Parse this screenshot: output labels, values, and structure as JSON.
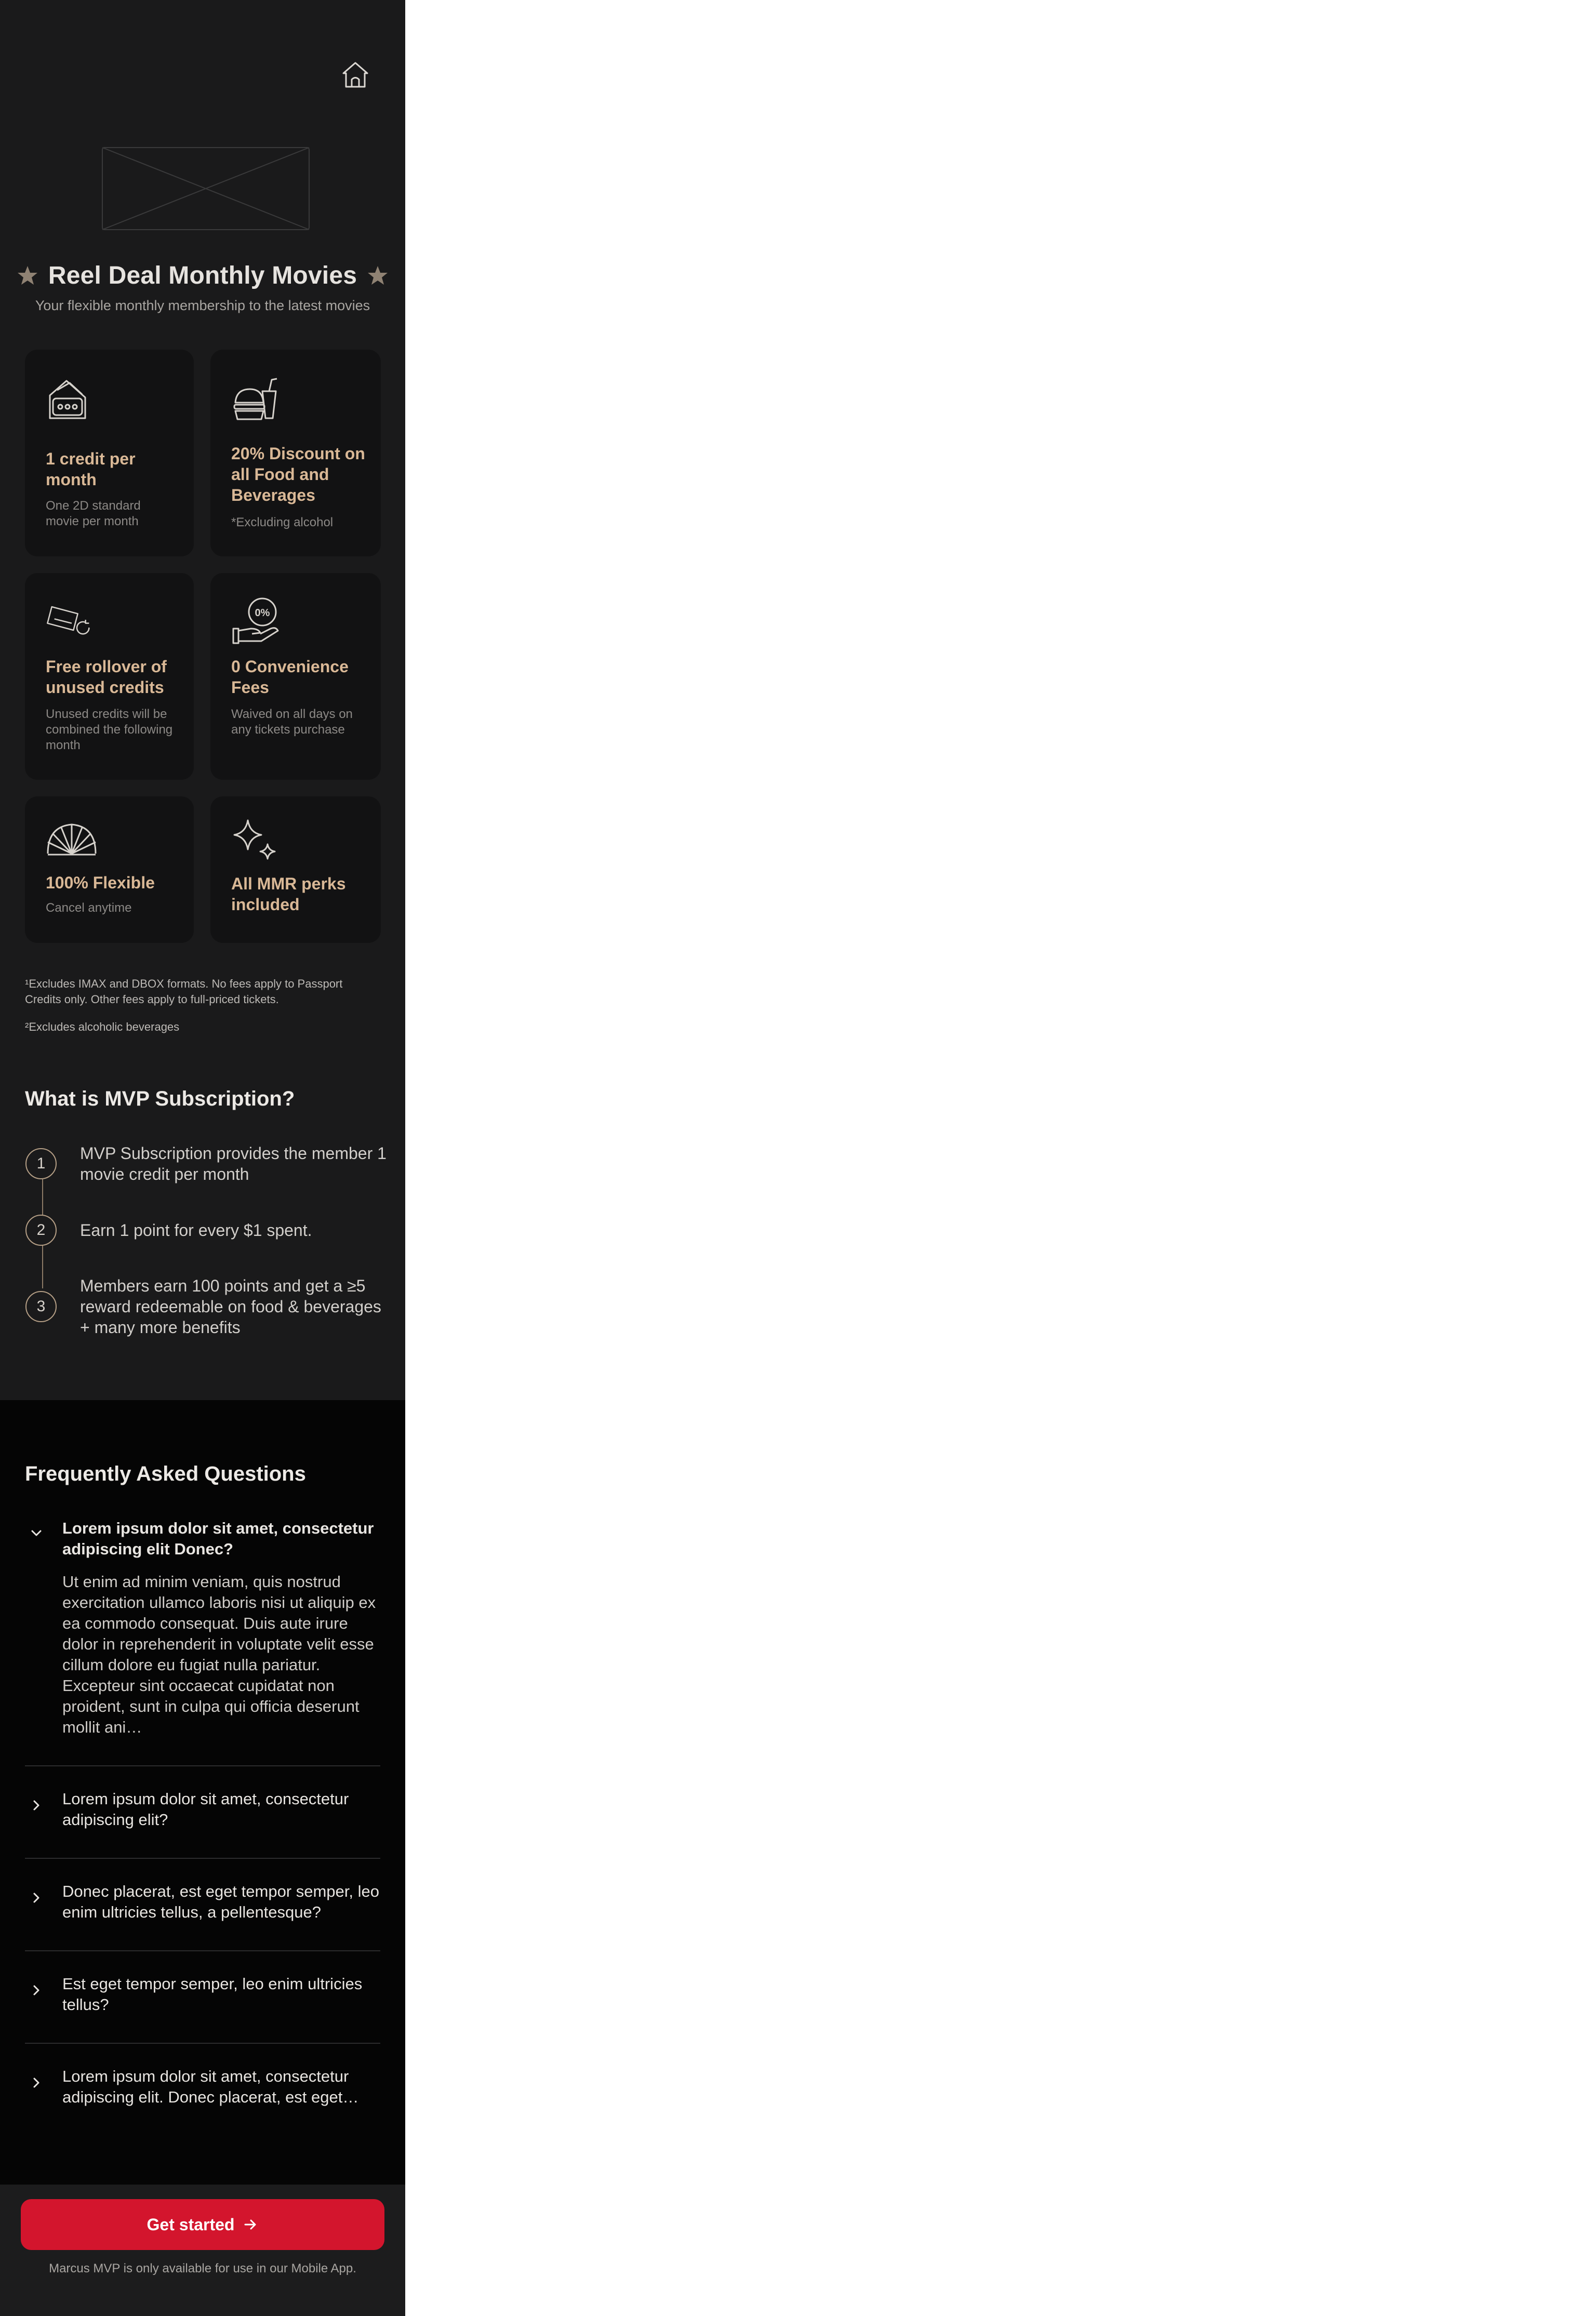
{
  "header": {
    "home_icon": "home-icon"
  },
  "hero": {
    "image_placeholder": "image-placeholder",
    "title": "Reel Deal Monthly Movies",
    "subtitle": "Your flexible monthly membership to the latest movies"
  },
  "benefits": [
    {
      "icon": "ticket-icon",
      "title": "1 credit per month",
      "description": "One 2D standard movie per month"
    },
    {
      "icon": "food-drink-icon",
      "title": "20% Discount on all Food and Beverages",
      "description": "*Excluding alcohol"
    },
    {
      "icon": "ticket-rollover-icon",
      "title": "Free rollover of unused credits",
      "description": "Unused credits will be combined the following month"
    },
    {
      "icon": "zero-percent-hand-icon",
      "title": "0 Convenience Fees",
      "description": "Waived on all days on any tickets purchase"
    },
    {
      "icon": "flexible-fan-icon",
      "title": "100% Flexible",
      "description": "Cancel anytime"
    },
    {
      "icon": "sparkles-icon",
      "title": "All MMR perks included",
      "description": ""
    }
  ],
  "footnotes": [
    "¹Excludes IMAX and DBOX formats. No fees apply to Passport Credits only. Other fees apply to full‑priced tickets.",
    "²Excludes alcoholic beverages"
  ],
  "mvp": {
    "title": "What is MVP Subscription?",
    "steps": [
      {
        "number": "1",
        "text": "MVP Subscription provides the member 1 movie credit per month"
      },
      {
        "number": "2",
        "text": "Earn 1 point for every $1 spent."
      },
      {
        "number": "3",
        "text": "Members earn 100 points and get a ≥5 reward redeemable on food & beverages + many more benefits"
      }
    ]
  },
  "faq": {
    "title": "Frequently Asked Questions",
    "items": [
      {
        "question": "Lorem ipsum dolor sit amet, consectetur adipiscing elit Donec?",
        "expanded": true,
        "answer": "Ut enim ad minim veniam, quis nostrud exercitation ullamco laboris nisi ut aliquip ex ea commodo consequat. Duis aute irure dolor in reprehenderit in voluptate velit esse cillum dolore eu fugiat nulla pariatur. Excepteur sint occaecat cupidatat non proident, sunt in culpa qui officia deserunt mollit ani…"
      },
      {
        "question": "Lorem ipsum dolor sit amet, consectetur adipiscing elit?",
        "expanded": false
      },
      {
        "question": "Donec placerat, est eget tempor semper, leo enim ultricies tellus, a pellentesque?",
        "expanded": false
      },
      {
        "question": "Est eget tempor semper, leo enim ultricies tellus?",
        "expanded": false
      },
      {
        "question": "Lorem ipsum dolor sit amet, consectetur adipiscing elit. Donec placerat, est eget…",
        "expanded": false
      }
    ]
  },
  "cta": {
    "label": "Get started",
    "note": "Marcus MVP is only available for use in our Mobile App."
  },
  "colors": {
    "accent": "#d3152d",
    "gold": "#d9b896",
    "background": "#1a1a1b"
  }
}
